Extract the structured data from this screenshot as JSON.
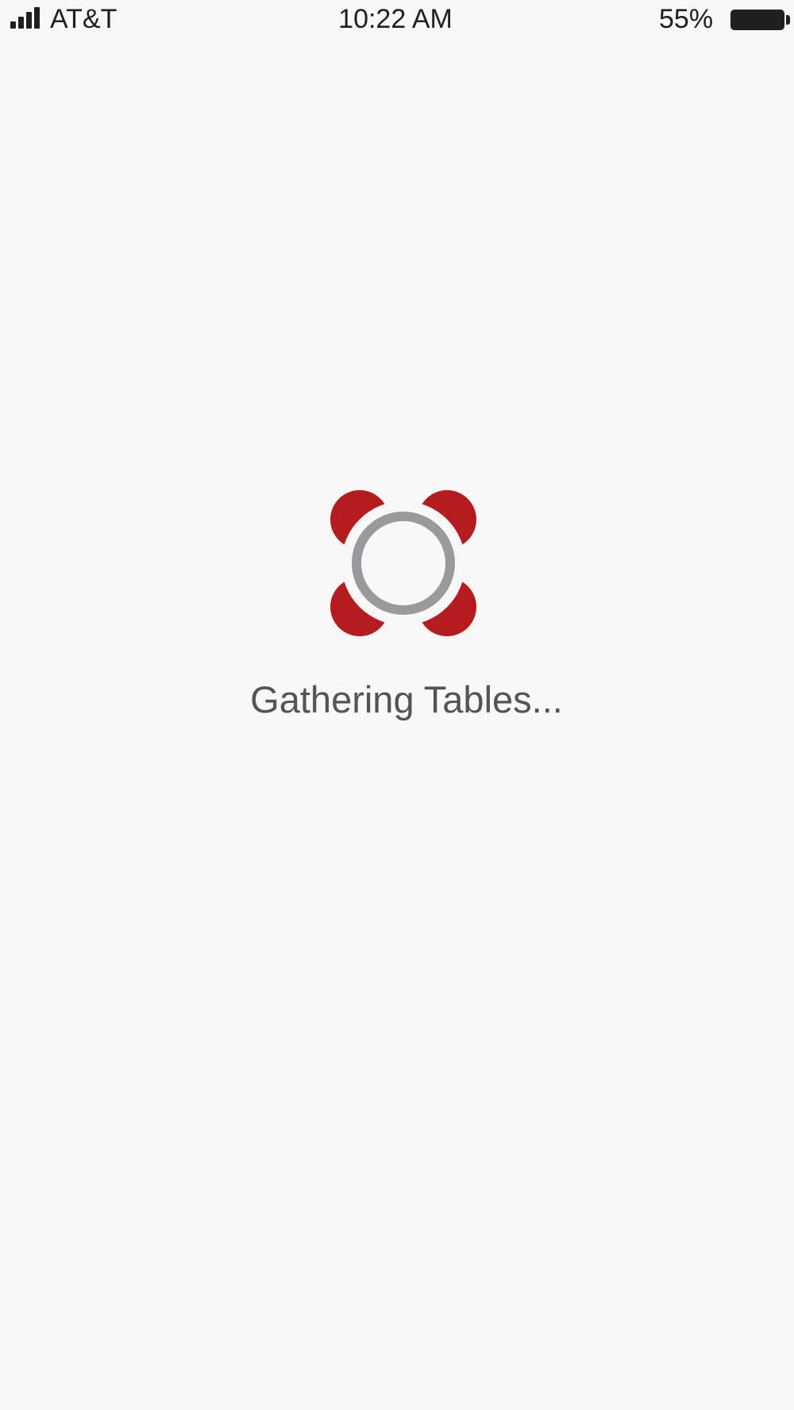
{
  "status_bar": {
    "carrier": "AT&T",
    "time": "10:22 AM",
    "battery_percent": "55%",
    "battery_level": 0.55
  },
  "loading": {
    "message": "Gathering Tables...",
    "logo_icon": "tables-logo-icon"
  },
  "colors": {
    "background": "#f8f8f8",
    "logo_red": "#b51b1f",
    "logo_ring": "#9a9a9c",
    "text": "#545454",
    "status_text": "#1f1f1f"
  }
}
